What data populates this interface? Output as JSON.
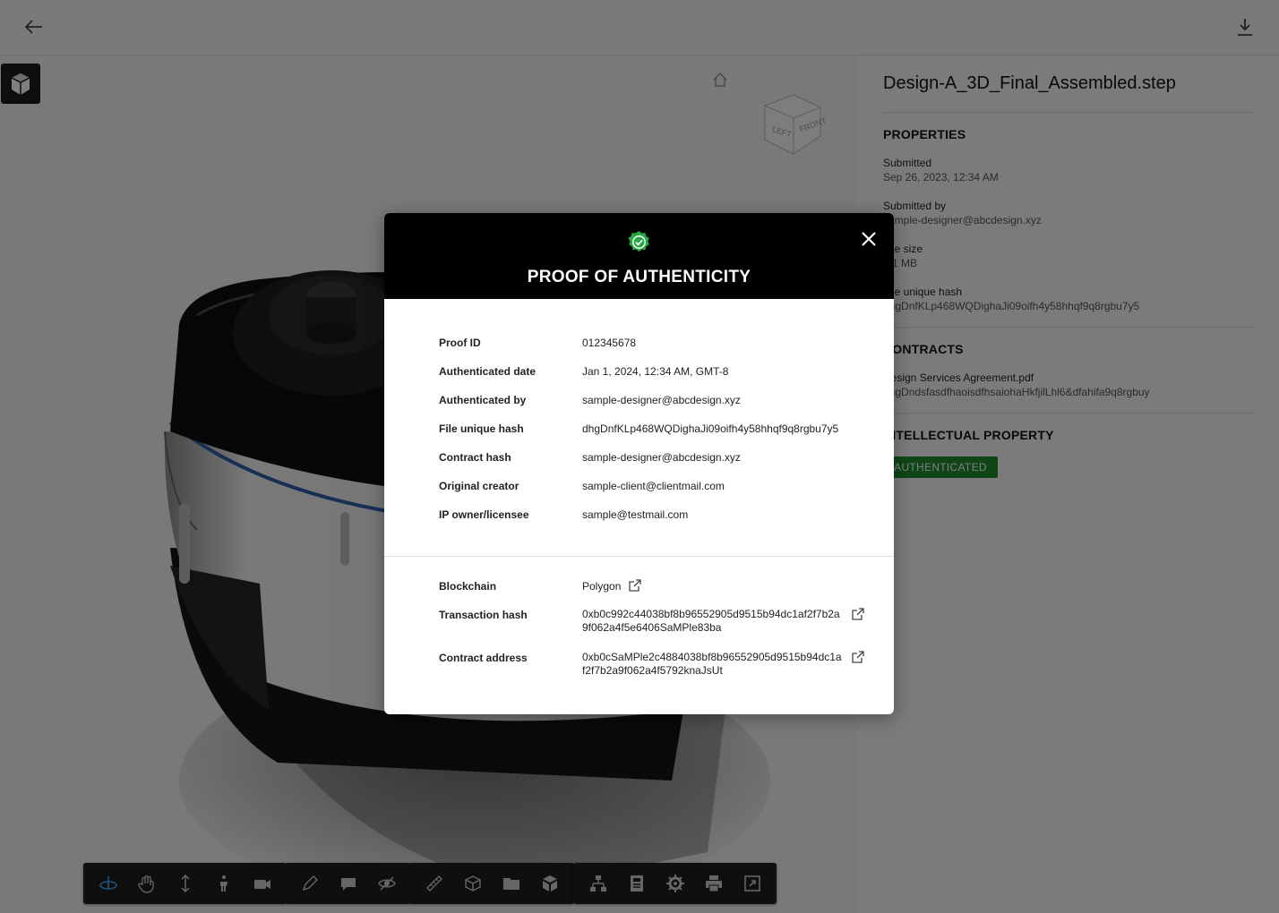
{
  "app": {
    "back_icon": "arrow-left-icon",
    "download_icon": "download-icon"
  },
  "side_panel": {
    "file_name": "Design-A_3D_Final_Assembled.step",
    "properties_heading": "PROPERTIES",
    "submitted_label": "Submitted",
    "submitted_value": "Sep 26, 2023, 12:34 AM",
    "submitted_by_label": "Submitted by",
    "submitted_by_value": "sample-designer@abcdesign.xyz",
    "file_size_label": "File size",
    "file_size_value": "2.1 MB",
    "file_hash_label": "File unique hash",
    "file_hash_value": "dhgDnfKLp468WQDighaJi09oifh4y58hhqf9q8rgbu7y5",
    "contracts_heading": "CONTRACTS",
    "contract_name": "Design Services Agreement.pdf",
    "contract_hash": "dhgDndsfasdfhaoisdfhsaiohaHkfjilLhl6&dfahifa9q8rgbuy",
    "ip_heading": "INTELLECTUAL PROPERTY",
    "ip_status": "AUTHENTICATED",
    "ip_status_color": "#1f8a2e"
  },
  "modal": {
    "title": "PROOF OF AUTHENTICITY",
    "status_icon": "check-badge-icon",
    "close_icon": "close-icon",
    "rows": [
      {
        "label": "Proof ID",
        "value": "012345678"
      },
      {
        "label": "Authenticated date",
        "value": "Jan 1, 2024, 12:34 AM, GMT-8"
      },
      {
        "label": "Authenticated by",
        "value": "sample-designer@abcdesign.xyz"
      },
      {
        "label": "File unique hash",
        "value": "dhgDnfKLp468WQDighaJi09oifh4y58hhqf9q8rgbu7y5"
      },
      {
        "label": "Contract hash",
        "value": "sample-designer@abcdesign.xyz"
      },
      {
        "label": "Original creator",
        "value": "sample-client@clientmail.com"
      },
      {
        "label": "IP owner/licensee",
        "value": "sample@testmail.com"
      }
    ],
    "chain_rows": [
      {
        "label": "Blockchain",
        "value": "Polygon"
      },
      {
        "label": "Transaction hash",
        "value": "0xb0c992c44038bf8b96552905d9515b94dc1af2f7b2a9f062a4f5e6406SaMPle83ba"
      },
      {
        "label": "Contract address",
        "value": "0xb0cSaMPle2c4884038bf8b96552905d9515b94dc1af2f7b2a9f062a4f5792knaJsUt"
      }
    ],
    "external_link_icon": "external-link-icon"
  },
  "toolbar": {
    "groups": [
      [
        "orbit-icon",
        "pan-hand-icon",
        "zoom-icon",
        "walk-person-icon",
        "camera-icon"
      ],
      [
        "markup-pencil-icon",
        "comment-icon",
        "hide-eye-icon"
      ],
      [
        "measure-ruler-icon",
        "section-box-icon",
        "explode-folder-icon",
        "model-parts-icon"
      ],
      [
        "model-tree-icon",
        "properties-icon",
        "settings-gear-icon",
        "print-icon",
        "fullscreen-icon"
      ]
    ]
  }
}
